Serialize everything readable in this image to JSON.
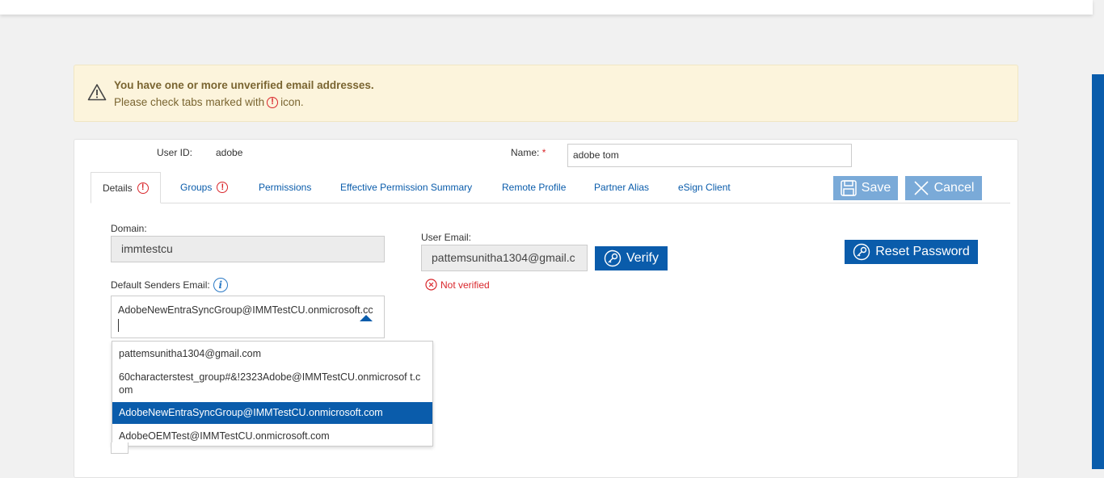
{
  "alert": {
    "title": "You have one or more unverified email addresses.",
    "sub_before": "Please check tabs marked with",
    "sub_after": "icon."
  },
  "header": {
    "user_id_label": "User ID:",
    "user_id_value": "adobe",
    "name_label": "Name:",
    "name_required": "*",
    "name_value": "adobe tom"
  },
  "tabs": [
    {
      "label": "Details",
      "warning": true,
      "active": true
    },
    {
      "label": "Groups",
      "warning": true
    },
    {
      "label": "Permissions"
    },
    {
      "label": "Effective Permission Summary"
    },
    {
      "label": "Remote Profile"
    },
    {
      "label": "Partner Alias"
    },
    {
      "label": "eSign Client"
    }
  ],
  "actions": {
    "save": "Save",
    "cancel": "Cancel",
    "verify": "Verify",
    "reset_password": "Reset Password"
  },
  "form": {
    "domain_label": "Domain:",
    "domain_value": "immtestcu",
    "user_email_label": "User Email:",
    "user_email_value": "pattemsunitha1304@gmail.c",
    "not_verified": "Not verified",
    "default_senders_label": "Default Senders Email:",
    "default_senders_value": "AdobeNewEntraSyncGroup@IMMTestCU.onmicrosoft.cc"
  },
  "dropdown": {
    "options": [
      "pattemsunitha1304@gmail.com",
      "60characterstest_group#&!2323Adobe@IMMTestCU.onmicrosof t.com",
      "AdobeNewEntraSyncGroup@IMMTestCU.onmicrosoft.com",
      "AdobeOEMTest@IMMTestCU.onmicrosoft.com"
    ],
    "selected_index": 2
  },
  "colors": {
    "brand": "#0a5cab",
    "warning": "#d9262b",
    "alert_bg": "#fcf4dc"
  }
}
